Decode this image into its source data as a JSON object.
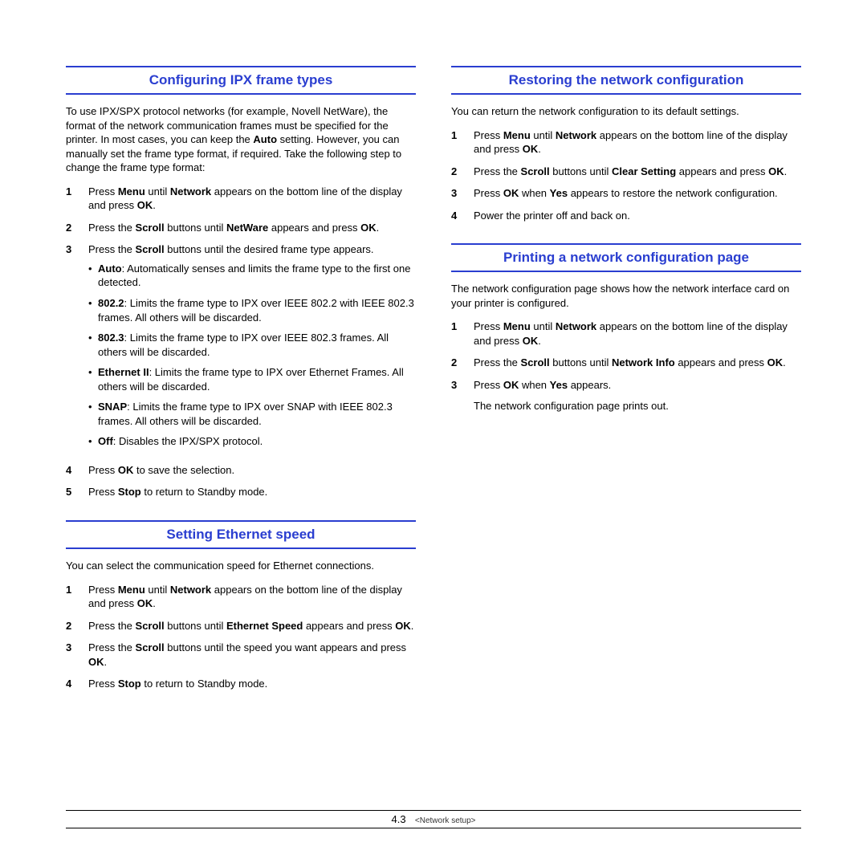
{
  "left": {
    "s1": {
      "title": "Configuring IPX frame types",
      "intro": "To use IPX/SPX protocol networks (for example, Novell NetWare), the format of the network communication frames must be specified for the printer. In most cases, you can keep the <b>Auto</b> setting. However, you can manually set the frame type format, if required. Take the following step to change the frame type format:",
      "steps": [
        "Press <b>Menu</b> until <b>Network</b> appears on the bottom line of the display and press <b>OK</b>.",
        "Press the <b>Scroll</b> buttons until <b>NetWare</b> appears and press <b>OK</b>.",
        "Press the <b>Scroll</b> buttons until the desired frame type appears.",
        "Press <b>OK</b> to save the selection.",
        "Press <b>Stop</b> to return to Standby mode."
      ],
      "bullets": [
        "<b>Auto</b>: Automatically senses and limits the frame type to the first one detected.",
        "<b>802.2</b>: Limits the frame type to IPX over IEEE 802.2 with IEEE 802.3 frames. All others will be discarded.",
        "<b>802.3</b>: Limits the frame type to IPX over IEEE 802.3 frames. All others will be discarded.",
        "<b>Ethernet II</b>: Limits the frame type to IPX over Ethernet Frames. All others will be discarded.",
        "<b>SNAP</b>: Limits the frame type to IPX over SNAP with IEEE 802.3 frames. All others will be discarded.",
        "<b>Off</b>: Disables the IPX/SPX protocol."
      ]
    },
    "s2": {
      "title": "Setting Ethernet speed",
      "intro": "You can select the communication speed for Ethernet connections.",
      "steps": [
        "Press <b>Menu</b> until <b>Network</b> appears on the bottom line of the display and press <b>OK</b>.",
        "Press the <b>Scroll</b> buttons until <b>Ethernet Speed</b> appears and press <b>OK</b>.",
        "Press the <b>Scroll</b> buttons until the speed you want appears and press <b>OK</b>.",
        "Press <b>Stop</b> to return to Standby mode."
      ]
    }
  },
  "right": {
    "s1": {
      "title": "Restoring the network configuration",
      "intro": "You can return the network configuration to its default settings.",
      "steps": [
        "Press <b>Menu</b> until <b>Network</b> appears on the bottom line of the display and press <b>OK</b>.",
        "Press the <b>Scroll</b> buttons until <b>Clear Setting</b> appears and press <b>OK</b>.",
        "Press <b>OK</b> when <b>Yes</b> appears to restore the network configuration.",
        "Power the printer off and back on."
      ]
    },
    "s2": {
      "title": "Printing a network configuration page",
      "intro": "The network configuration page shows how the network interface card on your printer is configured.",
      "steps": [
        "Press <b>Menu</b> until <b>Network</b> appears on the bottom line of the display and press <b>OK</b>.",
        "Press the <b>Scroll</b> buttons until <b>Network Info</b> appears and press <b>OK</b>.",
        "Press <b>OK</b> when <b>Yes</b> appears."
      ],
      "tail": "The network configuration page prints out."
    }
  },
  "footer": {
    "page": "4.3",
    "chapter": "<Network setup>"
  }
}
